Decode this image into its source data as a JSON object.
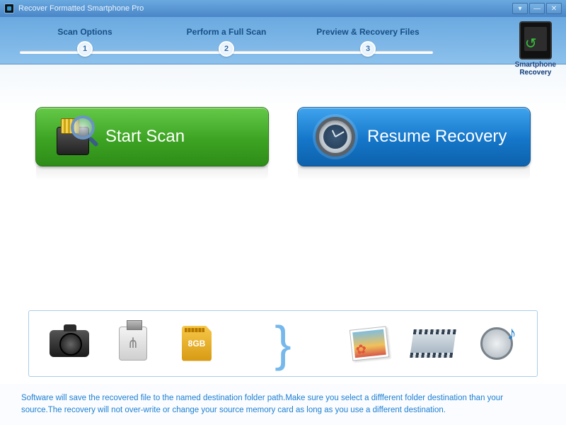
{
  "title": "Recover Formatted Smartphone Pro",
  "brand": {
    "line1": "Smartphone",
    "line2": "Recovery"
  },
  "steps": [
    {
      "n": "1",
      "label": "Scan Options"
    },
    {
      "n": "2",
      "label": "Perform a Full Scan"
    },
    {
      "n": "3",
      "label": "Preview & Recovery Files"
    }
  ],
  "actions": {
    "start_label": "Start Scan",
    "resume_label": "Resume Recovery"
  },
  "media": {
    "sd_label": "8GB"
  },
  "note": "Software will save the recovered file to the named destination folder path.Make sure you select a diffferent folder destination than your source.The recovery will not over-write or change your source memory card as long as you use a different destination."
}
